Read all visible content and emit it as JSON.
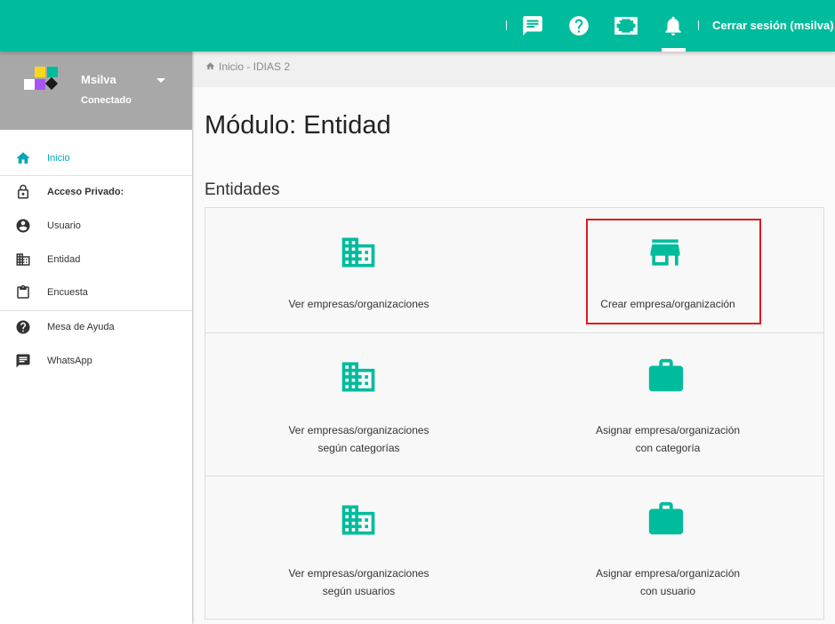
{
  "topbar": {
    "icons": [
      "chat-icon",
      "help-icon",
      "fullscreen-icon",
      "bell-icon"
    ],
    "logout_label": "Cerrar sesión (msilva)",
    "accent": "#00bc9c"
  },
  "sidebar": {
    "username": "Msilva",
    "status": "Conectado",
    "items": [
      {
        "label": "Inicio",
        "icon": "home-icon",
        "active": true
      },
      {
        "label": "Acceso Privado:",
        "icon": "lock-icon"
      },
      {
        "label": "Usuario",
        "icon": "user-icon"
      },
      {
        "label": "Entidad",
        "icon": "building-icon"
      },
      {
        "label": "Encuesta",
        "icon": "clipboard-icon"
      },
      {
        "label": "Mesa de Ayuda",
        "icon": "help-icon"
      },
      {
        "label": "WhatsApp",
        "icon": "chat-icon"
      }
    ]
  },
  "breadcrumb": "Inicio - IDIAS 2",
  "page_title": "Módulo: Entidad",
  "section_title": "Entidades",
  "cards": [
    {
      "label": "Ver empresas/organizaciones",
      "icon": "building-icon"
    },
    {
      "label": "Crear empresa/organización",
      "icon": "store-icon",
      "highlighted": true
    },
    {
      "label": "Ver empresas/organizaciones\nsegún categorías",
      "icon": "building-icon"
    },
    {
      "label": "Asignar empresa/organización\ncon categoría",
      "icon": "briefcase-icon"
    },
    {
      "label": "Ver empresas/organizaciones\nsegún usuarios",
      "icon": "building-icon"
    },
    {
      "label": "Asignar empresa/organización\ncon usuario",
      "icon": "briefcase-icon"
    }
  ],
  "colors": {
    "teal": "#00bc9c",
    "active_nav": "#00a7b5",
    "highlight": "#e0181c"
  }
}
